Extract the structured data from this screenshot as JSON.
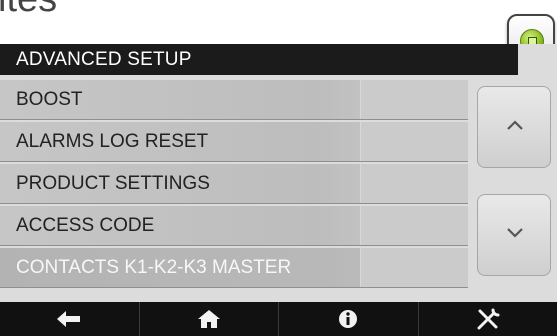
{
  "top_fragment": "ites:",
  "status_indicator": {
    "icon": "green-status-led-icon"
  },
  "header": {
    "title": "ADVANCED SETUP"
  },
  "menu": {
    "items": [
      {
        "label": "BOOST",
        "selected": false
      },
      {
        "label": "ALARMS LOG RESET",
        "selected": false
      },
      {
        "label": "PRODUCT SETTINGS",
        "selected": false
      },
      {
        "label": "ACCESS CODE",
        "selected": false
      },
      {
        "label": "CONTACTS K1-K2-K3 MASTER",
        "selected": true
      }
    ]
  },
  "scroll": {
    "up_icon": "chevron-up-icon",
    "down_icon": "chevron-down-icon"
  },
  "bottom_bar": {
    "buttons": [
      {
        "name": "back",
        "icon": "back-arrow-icon"
      },
      {
        "name": "home",
        "icon": "home-icon"
      },
      {
        "name": "info",
        "icon": "info-icon"
      },
      {
        "name": "settings",
        "icon": "tools-icon"
      }
    ]
  },
  "colors": {
    "title_bar": "#1b1b1b",
    "menu_item": "#c6c6c6",
    "bottom_bar": "#111111",
    "led_green": "#8fbf29"
  }
}
